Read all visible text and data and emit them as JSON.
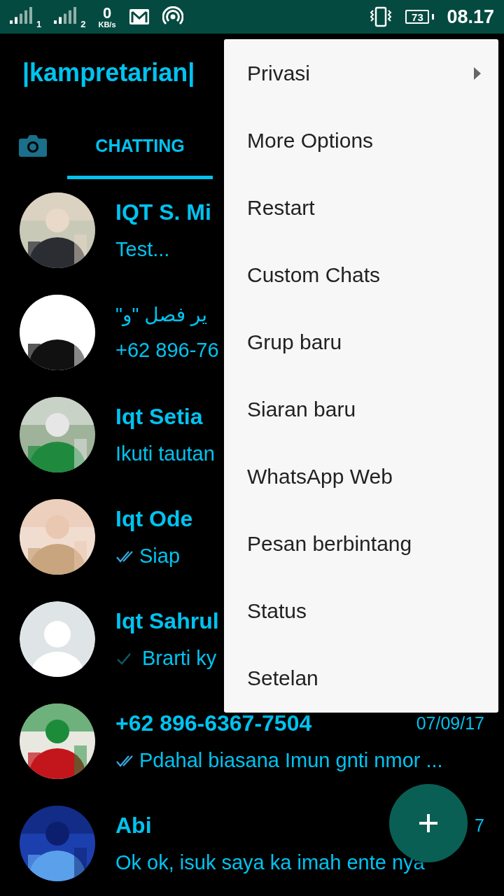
{
  "status_bar": {
    "sims": [
      {
        "label": "1"
      },
      {
        "label": "2"
      }
    ],
    "speed_value": "0",
    "speed_unit": "KB/s",
    "battery": "73",
    "time": "08.17"
  },
  "header": {
    "title": "|kampretarian|"
  },
  "tabs": [
    {
      "label": "CHATTING",
      "selected": true
    }
  ],
  "chats": [
    {
      "name": "IQT S. Mi",
      "message": "Test...",
      "kind": "picture"
    },
    {
      "name": "ير فصل \"و\"",
      "message": "+62 896-76",
      "kind": "picture"
    },
    {
      "name": "Iqt Setia",
      "message": "Ikuti tautan",
      "kind": "picture"
    },
    {
      "name": "Iqt Ode",
      "message": "Siap",
      "read": true,
      "kind": "picture"
    },
    {
      "name": "Iqt Sahrul",
      "message": "Brarti ky",
      "read": false,
      "kind": "default"
    },
    {
      "name": "+62 896-6367-7504",
      "time": "07/09/17",
      "message": "Pdahal biasana Imun gnti nmor ...",
      "read": true,
      "kind": "picture"
    },
    {
      "name": "Abi",
      "time": "7",
      "message": "Ok ok, isuk saya ka imah ente nya",
      "kind": "picture"
    }
  ],
  "menu": {
    "items": [
      {
        "label": "Privasi",
        "submenu": true
      },
      {
        "label": "More Options",
        "submenu": false
      },
      {
        "label": "Restart",
        "submenu": false
      },
      {
        "label": "Custom Chats",
        "submenu": false
      },
      {
        "label": "Grup baru",
        "submenu": false
      },
      {
        "label": "Siaran baru",
        "submenu": false
      },
      {
        "label": "WhatsApp Web",
        "submenu": false
      },
      {
        "label": "Pesan berbintang",
        "submenu": false
      },
      {
        "label": "Status",
        "submenu": false
      },
      {
        "label": "Setelan",
        "submenu": false
      }
    ]
  }
}
